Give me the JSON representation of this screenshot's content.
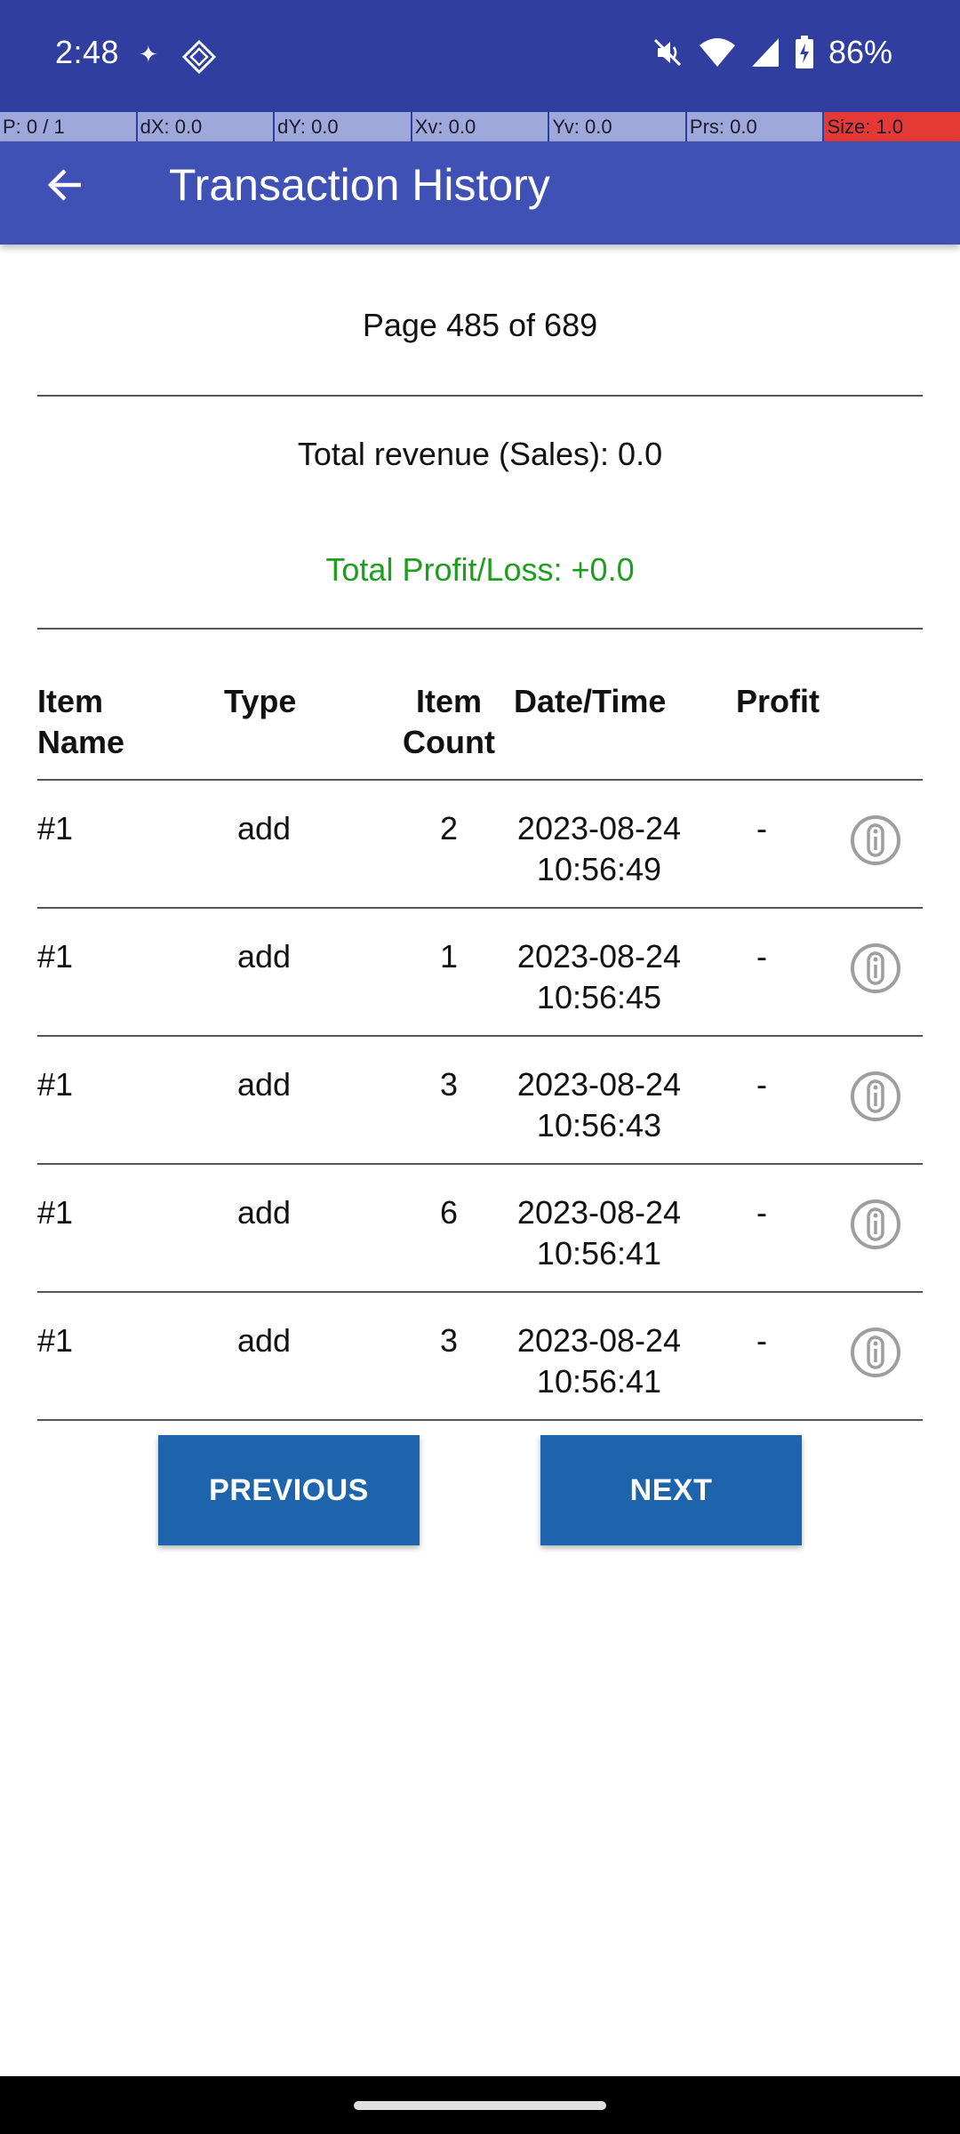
{
  "status": {
    "time": "2:48",
    "dot": "✦",
    "battery": "86%",
    "icons": [
      "sparkle-icon",
      "diamond-app-icon",
      "mute-icon",
      "wifi-icon",
      "cell-signal-icon",
      "battery-charging-icon"
    ]
  },
  "pointer": {
    "p": "P: 0 / 1",
    "dx": "dX: 0.0",
    "dy": "dY: 0.0",
    "xv": "Xv: 0.0",
    "yv": "Yv: 0.0",
    "prs": "Prs: 0.0",
    "size": "Size: 1.0"
  },
  "app_bar": {
    "title": "Transaction History",
    "back_icon": "arrow-back-icon"
  },
  "summary": {
    "page": "Page 485 of 689",
    "revenue": "Total revenue (Sales): 0.0",
    "profit": "Total Profit/Loss: +0.0"
  },
  "table": {
    "headers": {
      "item_name_1": "Item",
      "item_name_2": "Name",
      "type": "Type",
      "count_1": "Item",
      "count_2": "Count",
      "datetime": "Date/Time",
      "profit": "Profit"
    },
    "rows": [
      {
        "name": "#1",
        "type": "add",
        "count": "2",
        "date": "2023-08-24",
        "time": "10:56:49",
        "profit": "-"
      },
      {
        "name": "#1",
        "type": "add",
        "count": "1",
        "date": "2023-08-24",
        "time": "10:56:45",
        "profit": "-"
      },
      {
        "name": "#1",
        "type": "add",
        "count": "3",
        "date": "2023-08-24",
        "time": "10:56:43",
        "profit": "-"
      },
      {
        "name": "#1",
        "type": "add",
        "count": "6",
        "date": "2023-08-24",
        "time": "10:56:41",
        "profit": "-"
      },
      {
        "name": "#1",
        "type": "add",
        "count": "3",
        "date": "2023-08-24",
        "time": "10:56:41",
        "profit": "-"
      }
    ]
  },
  "buttons": {
    "previous": "PREVIOUS",
    "next": "NEXT"
  },
  "colors": {
    "status_bar": "#303f9f",
    "app_bar": "#3f51b5",
    "button": "#1e64ad",
    "profit_text": "#1e9e1e"
  }
}
